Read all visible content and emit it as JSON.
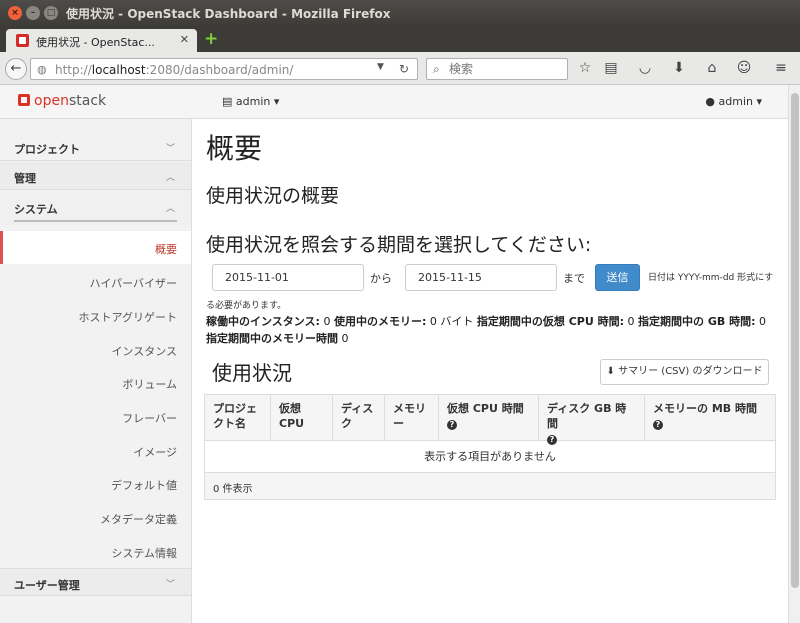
{
  "window": {
    "title": "使用状況 - OpenStack Dashboard - Mozilla Firefox"
  },
  "browser": {
    "tab_title": "使用状況 - OpenStac...",
    "url_prefix": "http://",
    "url_host": "localhost",
    "url_rest": ":2080/dashboard/admin/",
    "search_placeholder": "検索"
  },
  "header": {
    "logo_open": "open",
    "logo_stack": "stack",
    "project_label": "admin",
    "user_label": "admin"
  },
  "sidebar": {
    "project": "プロジェクト",
    "admin": "管理",
    "system": "システム",
    "items": [
      "概要",
      "ハイパーバイザー",
      "ホストアグリゲート",
      "インスタンス",
      "ボリューム",
      "フレーバー",
      "イメージ",
      "デフォルト値",
      "メタデータ定義",
      "システム情報"
    ],
    "identity": "ユーザー管理"
  },
  "main": {
    "page_title": "概要",
    "usage_summary": "使用状況の概要",
    "select_period": "使用状況を照会する期間を選択してください:",
    "start_date": "2015-11-01",
    "from": "から",
    "end_date": "2015-11-15",
    "until": "まで",
    "submit": "送信",
    "hint_line1": "日付は YYYY-mm-dd 形式にす",
    "hint_line2": "る必要があります。",
    "stats": {
      "active_instances_label": "稼働中のインスタンス:",
      "active_instances": "0",
      "active_memory_label": "使用中のメモリー:",
      "active_memory": "0 バイト",
      "vcpu_hours_label": "指定期間中の仮想 CPU 時間:",
      "vcpu_hours": "0",
      "gb_hours_label": "指定期間中の GB 時間:",
      "gb_hours": "0",
      "ram_hours_label": "指定期間中のメモリー時間",
      "ram_hours": "0"
    },
    "usage_title": "使用状況",
    "csv_button": "サマリー (CSV) のダウンロード",
    "table": {
      "columns": [
        "プロジェクト名",
        "仮想 CPU",
        "ディスク",
        "メモリー",
        "仮想 CPU 時間",
        "ディスク GB 時間",
        "メモリーの MB 時間"
      ],
      "empty_text": "表示する項目がありません",
      "footer": "0 件表示"
    }
  }
}
